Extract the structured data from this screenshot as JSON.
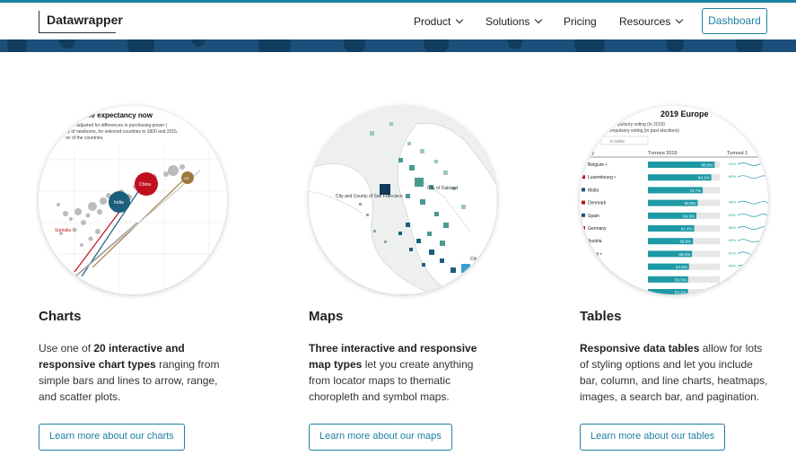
{
  "nav": {
    "logo": "Datawrapper",
    "items": [
      {
        "label": "Product",
        "dropdown": true
      },
      {
        "label": "Solutions",
        "dropdown": true
      },
      {
        "label": "Pricing",
        "dropdown": false
      },
      {
        "label": "Resources",
        "dropdown": true
      }
    ],
    "dashboard_label": "Dashboard"
  },
  "colors": {
    "accent": "#1d81a2",
    "banner": "#1b4f79",
    "chart_red": "#c0101e",
    "chart_teal": "#1b5f7d",
    "chart_brown": "#a07a3c",
    "map_dark": "#113a5b",
    "map_mid": "#3f8f8f",
    "table_bar": "#1d9aa6"
  },
  "features": [
    {
      "title": "Charts",
      "desc": {
        "pre": "Use one of ",
        "bold": "20 interactive and responsive chart types",
        "post": " ranging from simple bars and lines to arrow, range, and scatter plots."
      },
      "cta": "Learn more about our charts",
      "preview": {
        "title": "r life expectancy now",
        "sub1": "ation adjusted for differences in purchasing power (",
        "sub2": "cy of newborns, for selected countries in 1800 and 2015.",
        "sub3": "on of the countries.",
        "labels": [
          "China",
          "India",
          "Somalia",
          "US"
        ]
      }
    },
    {
      "title": "Maps",
      "desc": {
        "pre": "",
        "bold": "Three interactive and responsive map types",
        "post": " let you create anything from locator maps to thematic choropleth and symbol maps."
      },
      "cta": "Learn more about our maps",
      "preview": {
        "labels": [
          "City of Oakland",
          "City and County of San Francisco",
          "City"
        ]
      }
    },
    {
      "title": "Tables",
      "desc": {
        "pre": "",
        "bold": "Responsive data tables",
        "post": " allow for lots of styling options and let you include bar, column, and line charts, heatmaps, images, a search bar, and pagination."
      },
      "cta": "Learn more about our tables",
      "preview": {
        "title": "2019 Europe",
        "sub1": "ompulsory voting (in 2019)",
        "sub2": "compulsory voting (in past elections)",
        "search": "in table",
        "headers": [
          "untry",
          "Turnout 2019",
          "Turnout 1"
        ],
        "rows": [
          {
            "country": "Belgium •",
            "value": "88.5%",
            "pct": 88.5,
            "spark": "91%"
          },
          {
            "country": "Luxembourg •",
            "value": "84.1%",
            "pct": 84.1,
            "spark": "89%"
          },
          {
            "country": "Malta",
            "value": "72.7%",
            "pct": 72.7,
            "spark": ""
          },
          {
            "country": "Denmark",
            "value": "66.0%",
            "pct": 66.0,
            "spark": "48%"
          },
          {
            "country": "Spain",
            "value": "64.3%",
            "pct": 64.3,
            "spark": "69%"
          },
          {
            "country": "Germany",
            "value": "61.4%",
            "pct": 61.4,
            "spark": "55%"
          },
          {
            "country": "Austria",
            "value": "59.8%",
            "pct": 59.8,
            "spark": "49%"
          },
          {
            "country": "reece •",
            "value": "58.5%",
            "pct": 58.5,
            "spark": "51%"
          },
          {
            "country": "",
            "value": "54.5%",
            "pct": 54.5,
            "spark": "65%"
          },
          {
            "country": "",
            "value": "53.3%",
            "pct": 53.3,
            "spark": ""
          },
          {
            "country": "",
            "value": "53.1%",
            "pct": 53.1,
            "spark": ""
          }
        ]
      }
    }
  ]
}
